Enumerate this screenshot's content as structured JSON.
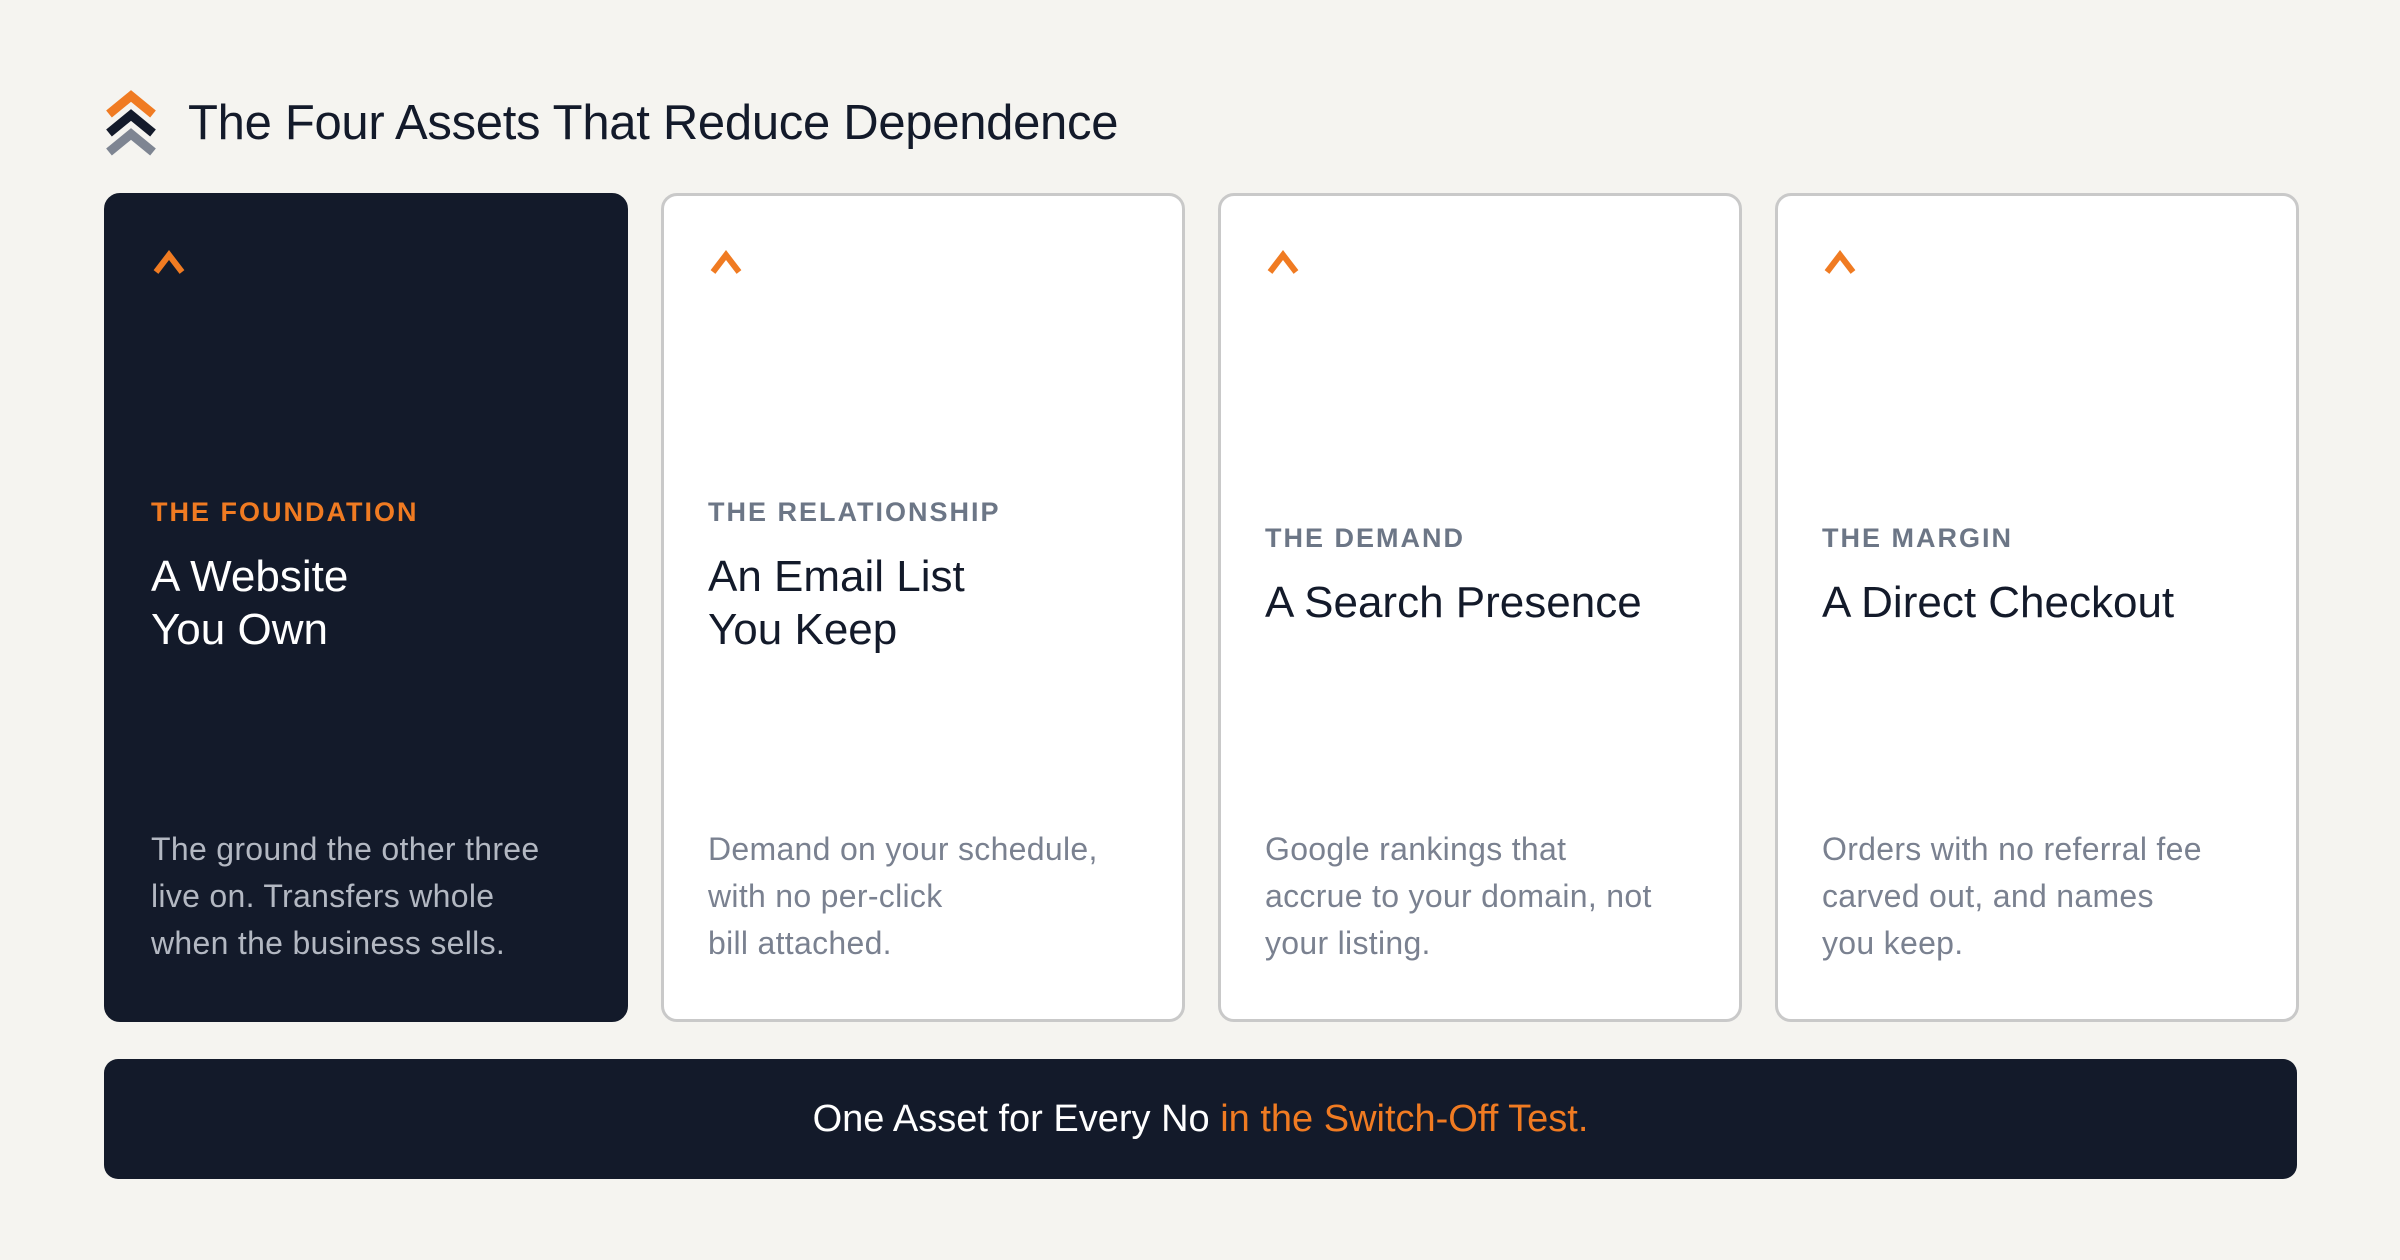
{
  "header": {
    "title": "The Four Assets That Reduce Dependence",
    "logo_icon": "stacked-chevrons-icon"
  },
  "colors": {
    "accent": "#f07b22",
    "navy": "#131a2a",
    "background": "#f5f4f0",
    "muted": "#6c7686",
    "logo_gray": "#7e8592"
  },
  "cards": [
    {
      "eyebrow": "THE FOUNDATION",
      "heading": "A Website\nYou Own",
      "description": "The ground the other three\nlive on. Transfers whole\nwhen the business sells.",
      "icon": "chevron-up-icon",
      "highlighted": true
    },
    {
      "eyebrow": "THE RELATIONSHIP",
      "heading": "An Email List\nYou Keep",
      "description": "Demand on your schedule,\nwith no per-click\nbill attached.",
      "icon": "chevron-up-icon",
      "highlighted": false
    },
    {
      "eyebrow": "THE DEMAND",
      "heading": "A Search Presence",
      "description": "Google rankings that\naccrue to your domain, not\nyour listing.",
      "icon": "chevron-up-icon",
      "highlighted": false
    },
    {
      "eyebrow": "THE MARGIN",
      "heading": "A Direct Checkout",
      "description": "Orders with no referral fee\ncarved out, and names\nyou keep.",
      "icon": "chevron-up-icon",
      "highlighted": false
    }
  ],
  "banner": {
    "text_primary": "One Asset for Every No ",
    "text_accent": "in the Switch-Off Test."
  }
}
